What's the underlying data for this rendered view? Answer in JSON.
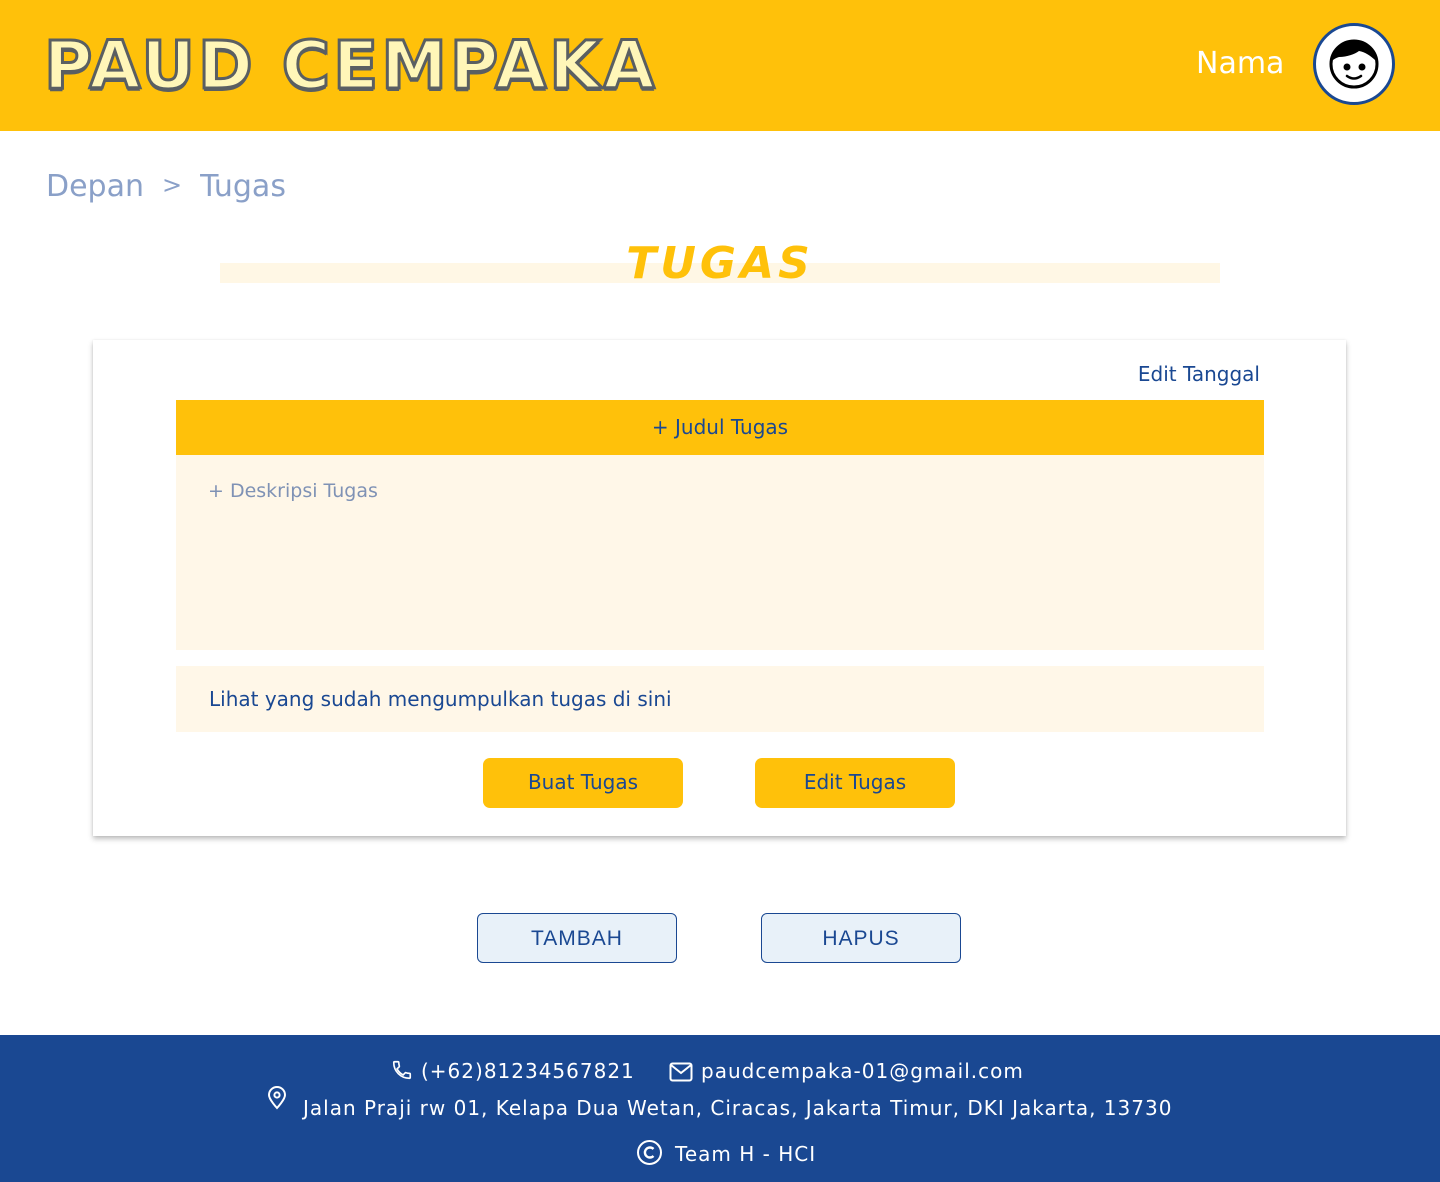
{
  "header": {
    "logo": "PAUD CEMPAKA",
    "user_name": "Nama"
  },
  "breadcrumb": {
    "home": "Depan",
    "separator": ">",
    "current": "Tugas"
  },
  "page": {
    "title": "TUGAS"
  },
  "card": {
    "edit_date": "Edit Tanggal",
    "task_title_placeholder": "+ Judul Tugas",
    "task_description_placeholder": "+ Deskripsi Tugas",
    "submissions_link": "Lihat yang sudah mengumpulkan tugas di sini",
    "create_button": "Buat Tugas",
    "edit_button": "Edit Tugas"
  },
  "actions": {
    "add_button": "TAMBAH",
    "delete_button": "HAPUS"
  },
  "footer": {
    "phone": "(+62)81234567821",
    "email": "paudcempaka-01@gmail.com",
    "address": "Jalan Praji rw 01, Kelapa Dua Wetan, Ciracas, Jakarta Timur, DKI Jakarta, 13730",
    "credit": "Team H - HCI"
  },
  "icons": {
    "avatar": "child-face-icon",
    "phone": "phone-icon",
    "email": "mail-icon",
    "address": "map-pin-icon",
    "copyright": "copyright-icon"
  },
  "colors": {
    "primary_yellow": "#ffc10a",
    "primary_blue": "#1a4892",
    "light_cream": "#fff7e8",
    "light_blue": "#e8f1f9"
  }
}
